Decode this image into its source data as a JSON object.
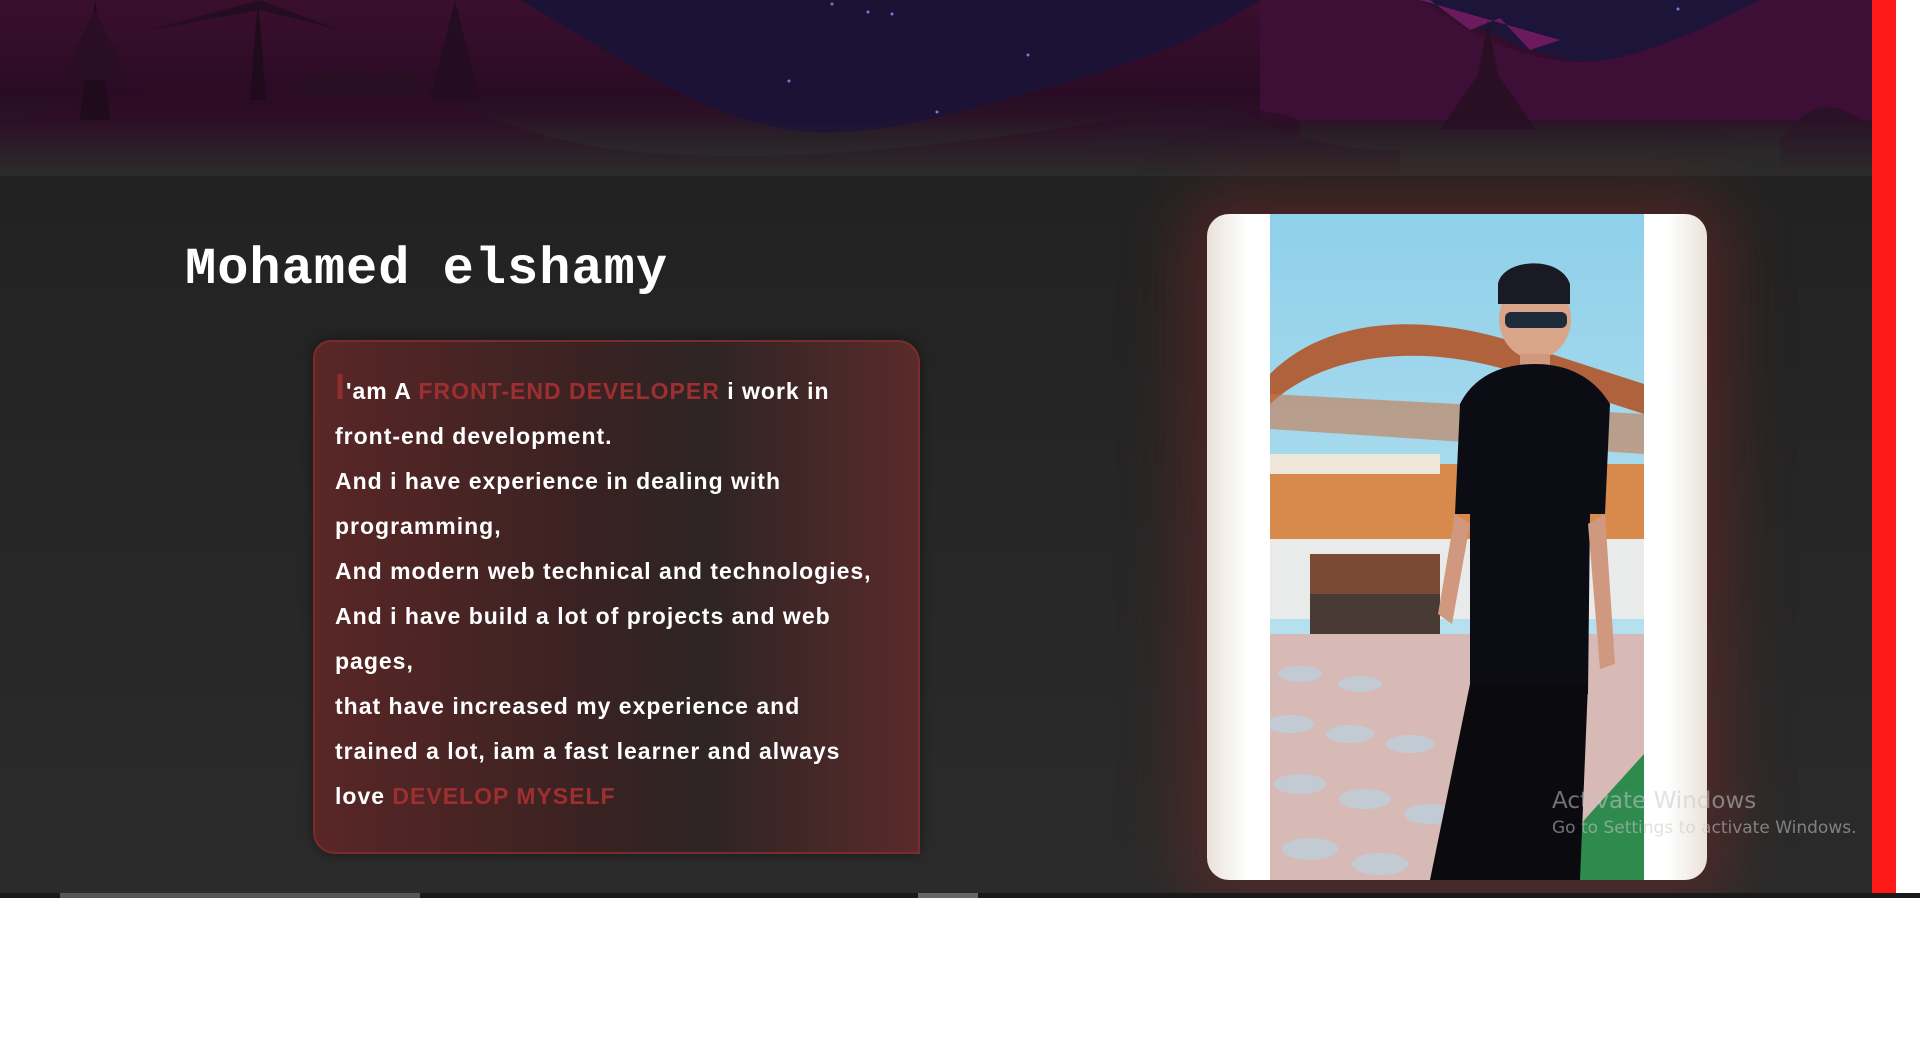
{
  "hero": {
    "scene": "night-landscape-mountains-trees"
  },
  "about": {
    "name": "Mohamed elshamy",
    "bio": {
      "first_letter": "I",
      "line1_a": "'am A ",
      "line1_accent": "FRONT-END DEVELOPER",
      "line1_b": " i work in",
      "line2": "front-end development.",
      "line3": "And i have experience in dealing with",
      "line4": "programming,",
      "line5": "And modern web technical and technologies,",
      "line6": "And i have build a lot of projects and web",
      "line7": "pages,",
      "line8": "that have increased my experience and",
      "line9": "trained a lot, iam a fast learner and always",
      "line10_a": "love ",
      "line10_accent": "DEVELOP MYSELF"
    },
    "photo": {
      "subject": "profile-photo-man-in-black-tshirt-sunglasses"
    }
  },
  "watermark": {
    "title": "Activate Windows",
    "subtitle": "Go to Settings to activate Windows."
  },
  "colors": {
    "accent": "#9e2f30",
    "scroll_accent": "#ff1a1a",
    "background": "#2a2a2a"
  }
}
